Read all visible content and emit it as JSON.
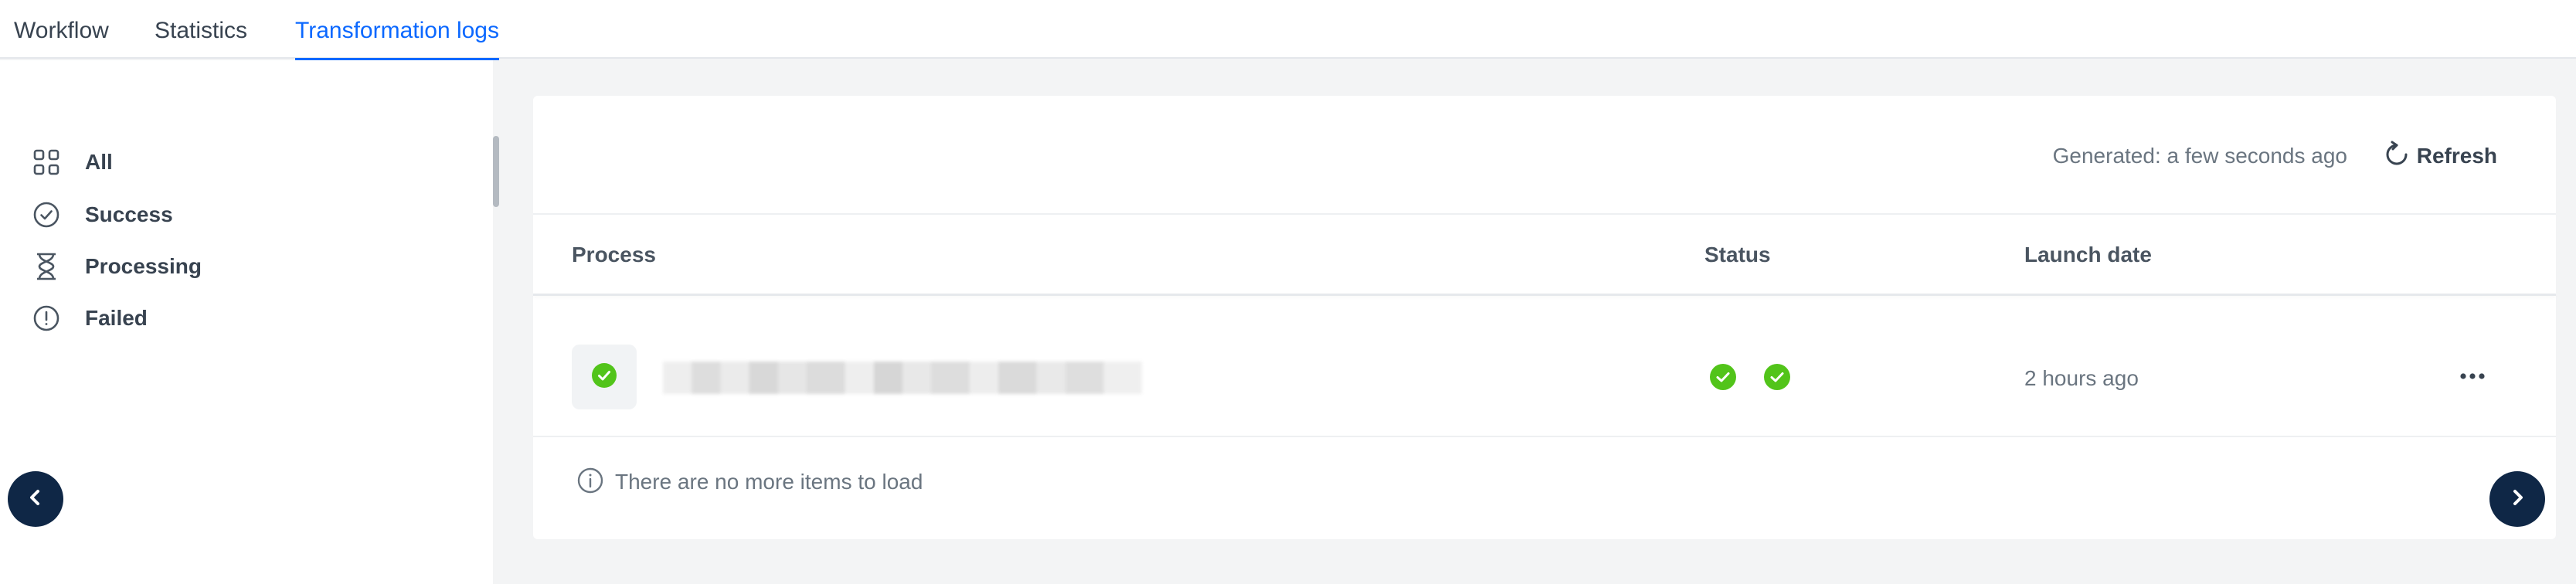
{
  "tabs": [
    {
      "label": "Workflow",
      "active": false
    },
    {
      "label": "Statistics",
      "active": false
    },
    {
      "label": "Transformation logs",
      "active": true
    }
  ],
  "sidebar": {
    "filters": [
      {
        "label": "All",
        "icon": "grid-icon"
      },
      {
        "label": "Success",
        "icon": "check-circle-icon"
      },
      {
        "label": "Processing",
        "icon": "hourglass-icon"
      },
      {
        "label": "Failed",
        "icon": "alert-circle-icon"
      }
    ]
  },
  "card": {
    "generated": "Generated: a few seconds ago",
    "refresh_label": "Refresh",
    "columns": {
      "process": "Process",
      "status": "Status",
      "launch_date": "Launch date"
    },
    "rows": [
      {
        "process_name": "",
        "status_icons": [
          "success",
          "success"
        ],
        "launch_date": "2 hours ago"
      }
    ],
    "no_more": "There are no more items to load"
  },
  "colors": {
    "accent": "#0b68ff",
    "success": "#52c41a",
    "nav_button": "#0f2746"
  }
}
